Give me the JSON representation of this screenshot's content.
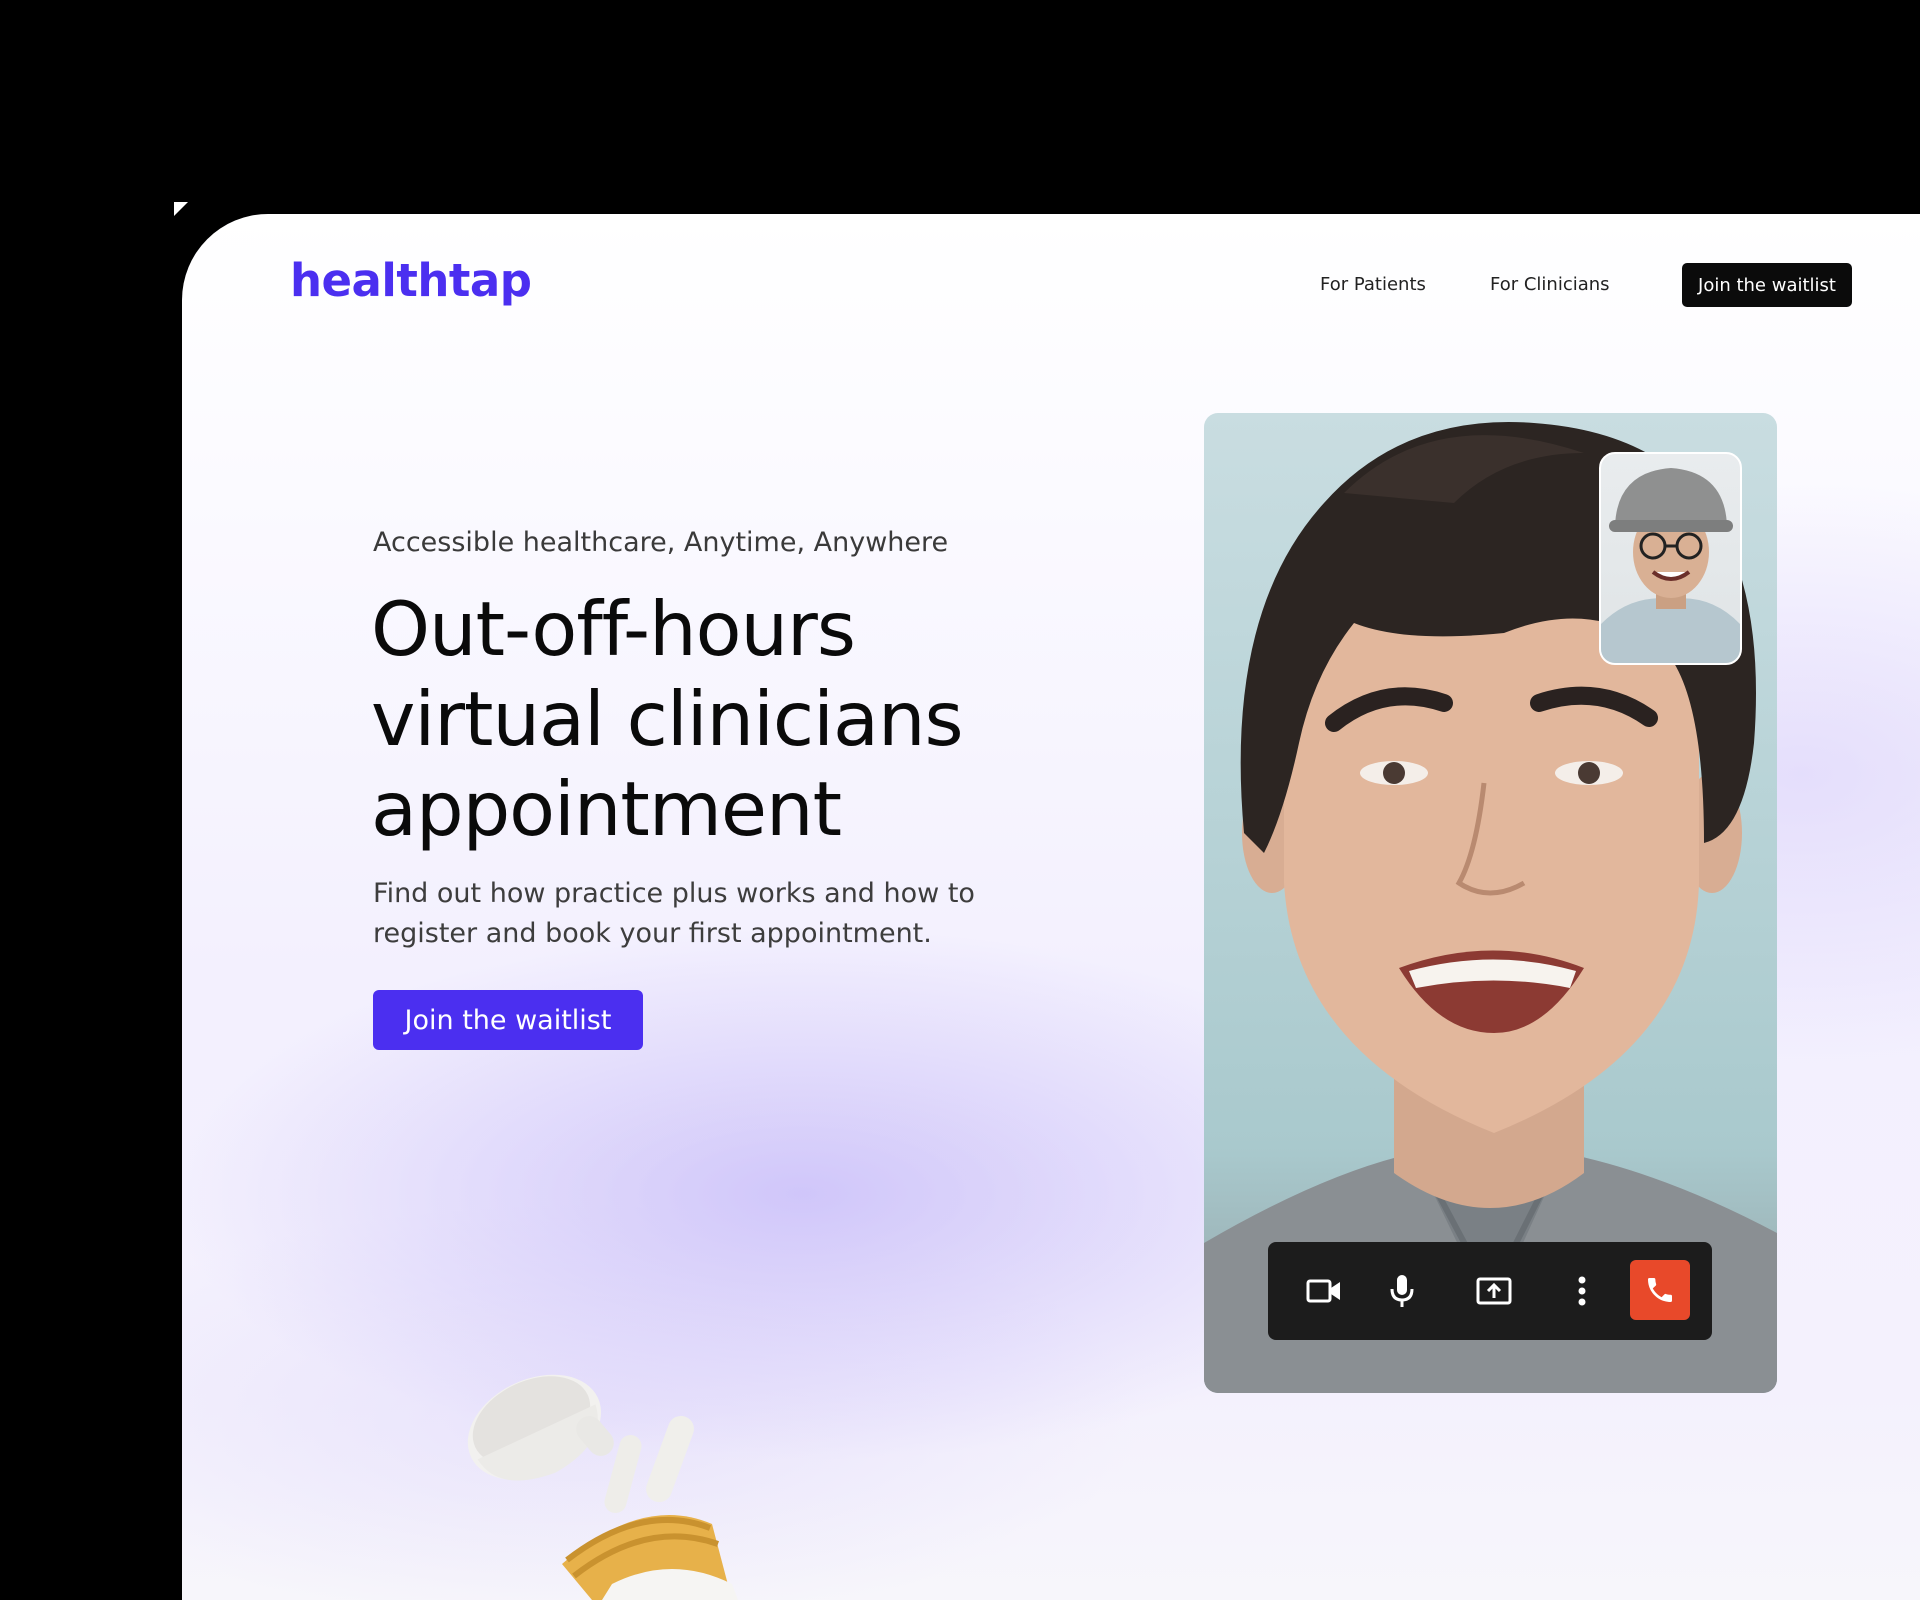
{
  "brand": {
    "logo": "healthtap",
    "accent": "#4b2ff0"
  },
  "nav": {
    "links": [
      "For Patients",
      "For Clinicians"
    ],
    "cta": "Join the waitlist"
  },
  "hero": {
    "eyebrow": "Accessible healthcare, Anytime, Anywhere",
    "headline_lines": [
      "Out-off-hours",
      "virtual clinicians",
      "appointment"
    ],
    "lede": "Find out how practice plus works and how to register and book your first appointment.",
    "cta": "Join the waitlist"
  },
  "call": {
    "controls": [
      "video-camera-icon",
      "microphone-icon",
      "screen-share-icon",
      "more-options-icon",
      "end-call-icon"
    ],
    "end_call_color": "#e8492a"
  }
}
